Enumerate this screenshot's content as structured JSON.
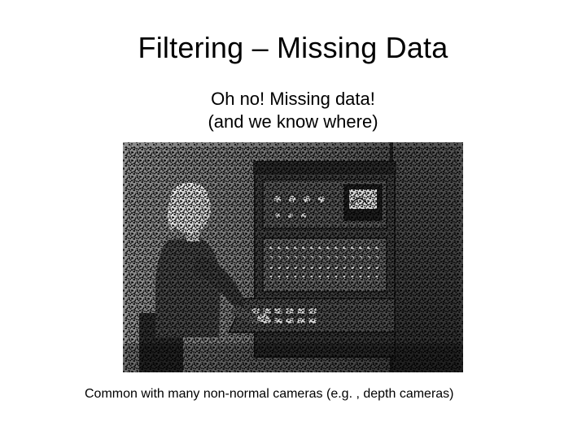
{
  "slide": {
    "title": "Filtering – Missing Data",
    "subtitle_line1": "Oh no! Missing data!",
    "subtitle_line2": "(and we know where)",
    "caption": "Common with many non-normal cameras (e.g. , depth cameras)",
    "image_alt": "grayscale-photo-person-at-vintage-computer-with-speckle-noise"
  }
}
